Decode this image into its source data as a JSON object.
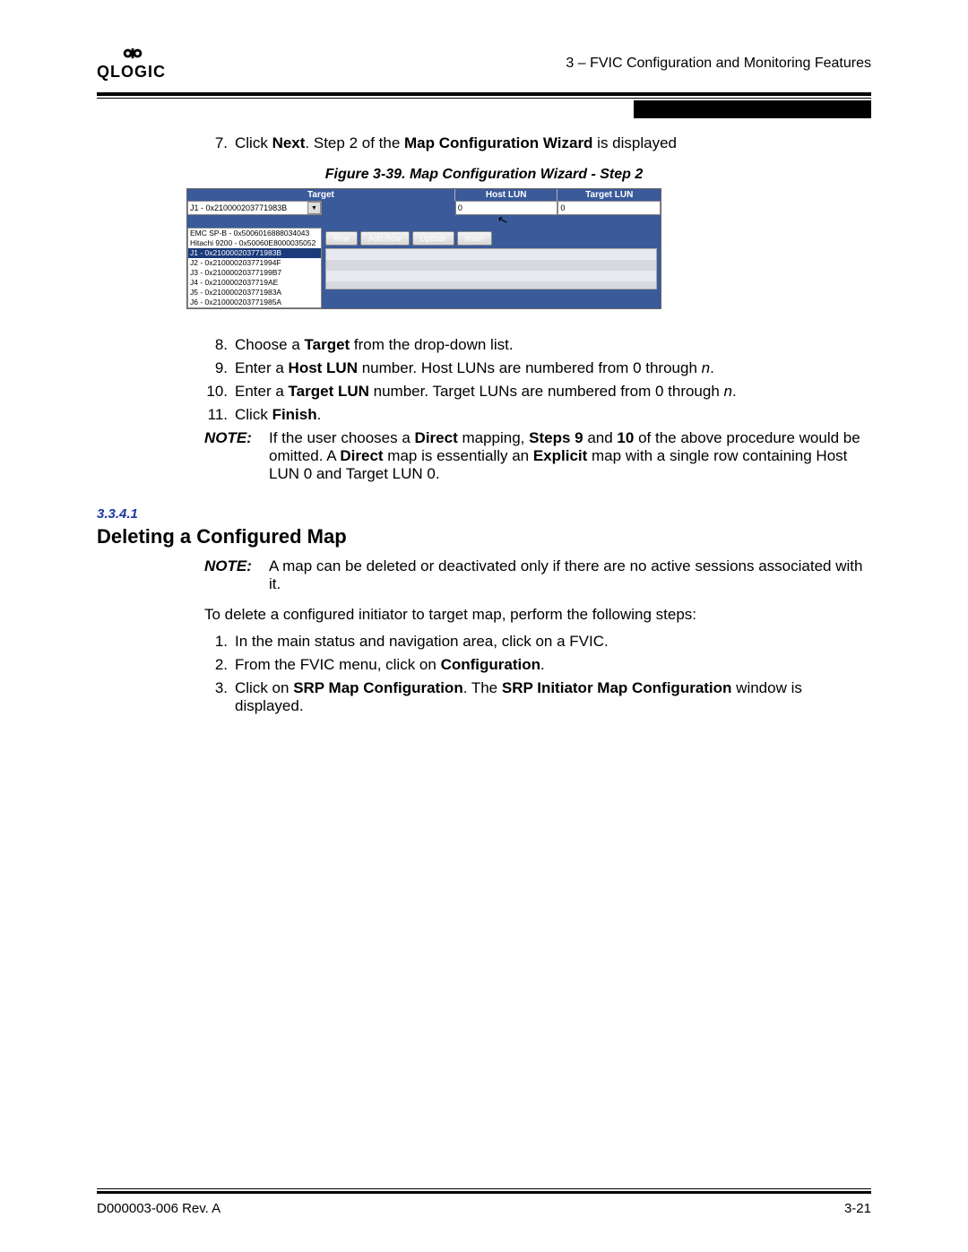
{
  "header": {
    "logo_text": "QLOGIC",
    "chapter_line": "3 – FVIC Configuration and Monitoring Features"
  },
  "step7": {
    "num": "7.",
    "text_pre": "Click ",
    "b1": "Next",
    "text_mid": ". Step 2 of the ",
    "b2": "Map Configuration Wizard",
    "text_post": " is displayed"
  },
  "figure_caption": "Figure 3-39. Map Configuration Wizard - Step 2",
  "fig": {
    "col_target": "Target",
    "col_host": "Host LUN",
    "col_tlun": "Target LUN",
    "selected": "J1 - 0x210000203771983B",
    "host_val": "0",
    "tlun_val": "0",
    "list": [
      "EMC SP-B - 0x5006016888034043",
      "Hitachi 9200 - 0x50060E8000035052",
      "J1 - 0x210000203771983B",
      "J2 - 0x210000203771994F",
      "J3 - 0x21000020377199B7",
      "J4 - 0x2100002037719AE",
      "J5 - 0x210000203771983A",
      "J6 - 0x210000203771985A"
    ],
    "list_sel_index": 2,
    "btn_row": "Row",
    "btn_addrow": "Add Row",
    "btn_update": "Update",
    "btn_finish": "finish"
  },
  "steps8to11": [
    {
      "num": "8.",
      "pre": "Choose a ",
      "b": "Target",
      "post": " from the drop-down list."
    },
    {
      "num": "9.",
      "pre": "Enter a ",
      "b": "Host LUN",
      "post": " number. Host LUNs are numbered from 0 through ",
      "it": "n",
      "post2": "."
    },
    {
      "num": "10.",
      "pre": "Enter a ",
      "b": "Target LUN",
      "post": " number. Target LUNs are numbered from 0 through ",
      "it": "n",
      "post2": "."
    },
    {
      "num": "11.",
      "pre": "Click ",
      "b": "Finish",
      "post": "."
    }
  ],
  "note1": {
    "label": "NOTE:",
    "t1": "If the user chooses a ",
    "b1": "Direct",
    "t2": " mapping, ",
    "b2": "Steps 9",
    "t3": " and ",
    "b3": "10",
    "t4": " of the above procedure would be omitted. A ",
    "b4": "Direct",
    "t5": " map is essentially an ",
    "b5": "Explicit",
    "t6": " map with a single row containing Host LUN 0 and Target LUN 0."
  },
  "section": {
    "num": "3.3.4.1",
    "title": "Deleting a Configured Map"
  },
  "note2": {
    "label": "NOTE:",
    "text": "A map can be deleted or deactivated only if there are no active sessions associated with it."
  },
  "lead": "To delete a configured initiator to target map, perform the following steps:",
  "steps_del": [
    {
      "num": "1.",
      "pre": "In the main status and navigation area, click on a FVIC."
    },
    {
      "num": "2.",
      "pre": "From the FVIC menu, click on ",
      "b": "Configuration",
      "post": "."
    },
    {
      "num": "3.",
      "pre": "Click on ",
      "b": "SRP Map Configuration",
      "mid": ". The ",
      "b2": "SRP Initiator Map Configuration",
      "post": " window is displayed."
    }
  ],
  "footer": {
    "left": "D000003-006 Rev. A",
    "right": "3-21"
  }
}
